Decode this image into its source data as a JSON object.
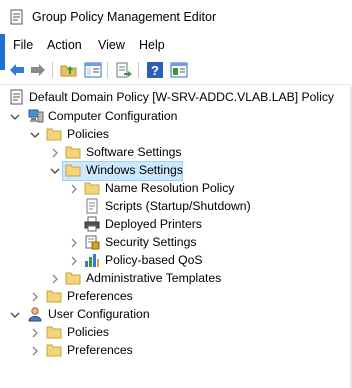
{
  "window": {
    "title": "Group Policy Management Editor"
  },
  "menu": [
    "File",
    "Action",
    "View",
    "Help"
  ],
  "toolbar": {
    "buttons": [
      "back-arrow-icon",
      "forward-arrow-icon",
      "up-folder-icon",
      "show-hide-tree-icon",
      "export-list-icon",
      "help-icon",
      "properties-view-icon"
    ]
  },
  "tree": {
    "root": "Default Domain Policy [W-SRV-ADDC.VLAB.LAB] Policy",
    "computer_configuration": "Computer Configuration",
    "policies": "Policies",
    "software_settings": "Software Settings",
    "windows_settings": "Windows Settings",
    "name_resolution_policy": "Name Resolution Policy",
    "scripts": "Scripts (Startup/Shutdown)",
    "deployed_printers": "Deployed Printers",
    "security_settings": "Security Settings",
    "policy_based_qos": "Policy-based QoS",
    "administrative_templates": "Administrative Templates",
    "preferences": "Preferences",
    "user_configuration": "User Configuration",
    "user_policies": "Policies",
    "user_preferences": "Preferences"
  },
  "colors": {
    "selection_bg": "#cce8ff",
    "selection_border": "#99d1ff",
    "folder": "#e8c060",
    "accent": "#1e6fd0"
  }
}
